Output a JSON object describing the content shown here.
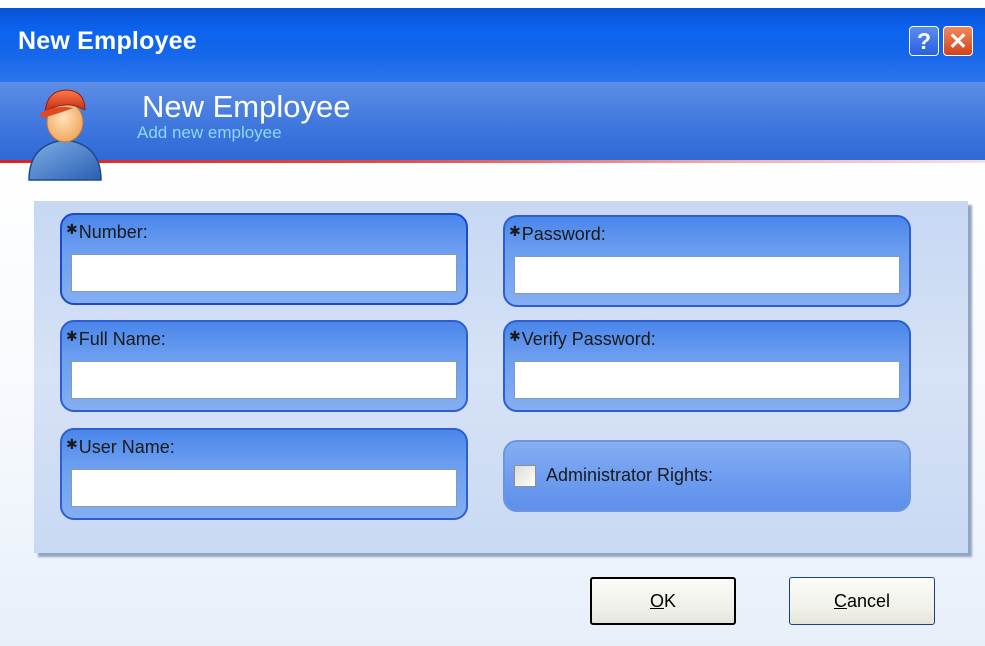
{
  "window": {
    "title": "New Employee",
    "help_glyph": "?",
    "close_glyph": "✕"
  },
  "header": {
    "title": "New Employee",
    "subtitle": "Add new employee",
    "icon": "employee-avatar-icon"
  },
  "form": {
    "required_marker": "✱",
    "number": {
      "label": "Number:",
      "value": ""
    },
    "full_name": {
      "label": "Full Name:",
      "value": ""
    },
    "user_name": {
      "label": "User Name:",
      "value": ""
    },
    "password": {
      "label": "Password:",
      "value": ""
    },
    "verify_password": {
      "label": "Verify Password:",
      "value": ""
    },
    "administrator_rights": {
      "label": "Administrator Rights:",
      "checked": false
    }
  },
  "buttons": {
    "ok": {
      "mnemonic": "O",
      "rest": "K"
    },
    "cancel": {
      "mnemonic": "C",
      "rest": "ancel"
    }
  },
  "colors": {
    "titlebar": "#0c63ee",
    "header_band": "#3f77de",
    "accent_line": "#e02020",
    "group_border": "#2f5fcf",
    "subtitle": "#8ed8f8"
  }
}
